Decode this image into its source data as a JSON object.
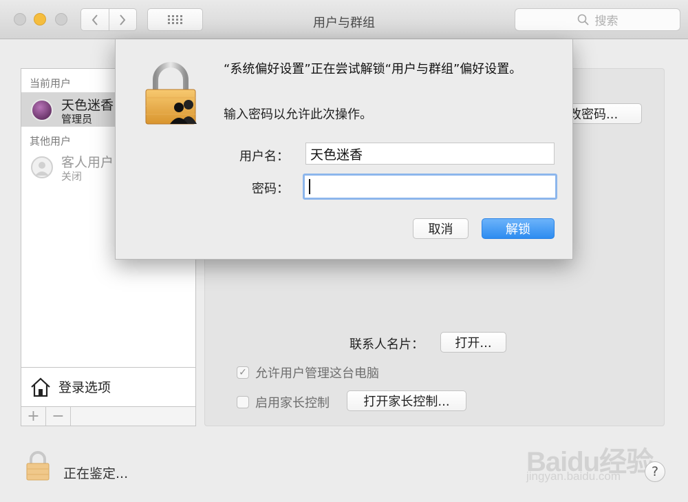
{
  "window": {
    "title": "用户与群组",
    "search_placeholder": "搜索"
  },
  "sidebar": {
    "current_users_label": "当前用户",
    "current_user": {
      "name": "天色迷香",
      "role": "管理员"
    },
    "other_users_label": "其他用户",
    "guest_user": {
      "name": "客人用户",
      "status": "关闭"
    },
    "login_options_label": "登录选项",
    "add_button": "+",
    "remove_button": "−"
  },
  "right_panel": {
    "change_password_partial": "改密码...",
    "contact_card_label": "联系人名片：",
    "open_button": "打开...",
    "allow_admin_label": "允许用户管理这台电脑",
    "allow_admin_checked": true,
    "parental_controls_label": "启用家长控制",
    "parental_controls_checked": false,
    "open_parental_button": "打开家长控制..."
  },
  "footer": {
    "status_text": "正在鉴定...",
    "help_label": "?"
  },
  "watermark": {
    "logo_text": "Bai",
    "logo_text2": "du",
    "logo_suffix": "经验",
    "url": "jingyan.baidu.com"
  },
  "dialog": {
    "title": "“系统偏好设置”正在尝试解锁“用户与群组”偏好设置。",
    "message": "输入密码以允许此次操作。",
    "username_label": "用户名：",
    "username_value": "天色迷香",
    "password_label": "密码：",
    "password_value": "",
    "cancel_button": "取消",
    "unlock_button": "解锁"
  },
  "colors": {
    "accent_blue": "#2d8cf0",
    "focus_ring": "#8cb6ec",
    "minimize_yellow": "#f5bd3e"
  }
}
